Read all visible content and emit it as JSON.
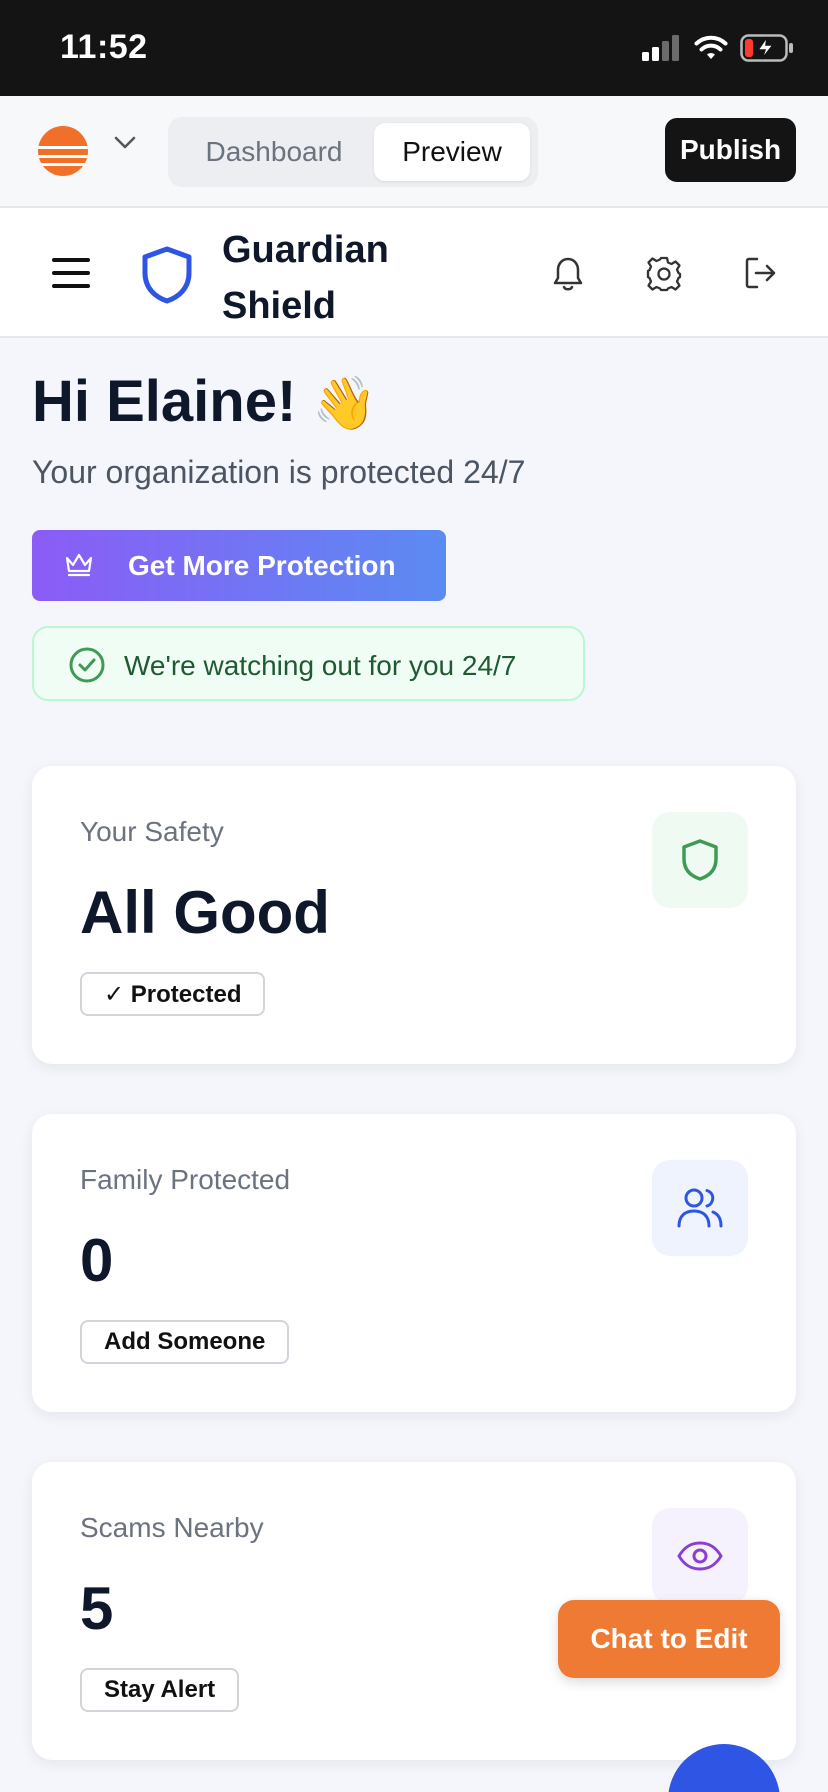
{
  "status_bar": {
    "time": "11:52"
  },
  "toolbar": {
    "tabs": [
      {
        "label": "Dashboard",
        "active": false
      },
      {
        "label": "Preview",
        "active": true
      }
    ],
    "publish_label": "Publish"
  },
  "header": {
    "brand_name": "Guardian Shield"
  },
  "main": {
    "greeting": "Hi Elaine!",
    "greeting_emoji": "👋",
    "subtitle": "Your organization is protected 24/7",
    "cta_label": "Get More Protection",
    "status_message": "We're watching out for you 24/7"
  },
  "cards": [
    {
      "label": "Your Safety",
      "value": "All Good",
      "badge": "✓ Protected",
      "icon": "shield-icon",
      "icon_color": "#3f9a57",
      "icon_bg": "#effaf2"
    },
    {
      "label": "Family Protected",
      "value": "0",
      "badge": "Add Someone",
      "icon": "users-icon",
      "icon_color": "#2f55e4",
      "icon_bg": "#eef3fd"
    },
    {
      "label": "Scams Nearby",
      "value": "5",
      "badge": "Stay Alert",
      "icon": "eye-icon",
      "icon_color": "#8a3fd1",
      "icon_bg": "#f6f2fd"
    }
  ],
  "chat_button": {
    "label": "Chat to Edit"
  },
  "colors": {
    "cta_gradient_start": "#8b5cf6",
    "cta_gradient_end": "#5b8bf2",
    "brand_blue": "#2f55e4",
    "chat_orange": "#ee7a34",
    "success_green": "#3f9a57"
  }
}
